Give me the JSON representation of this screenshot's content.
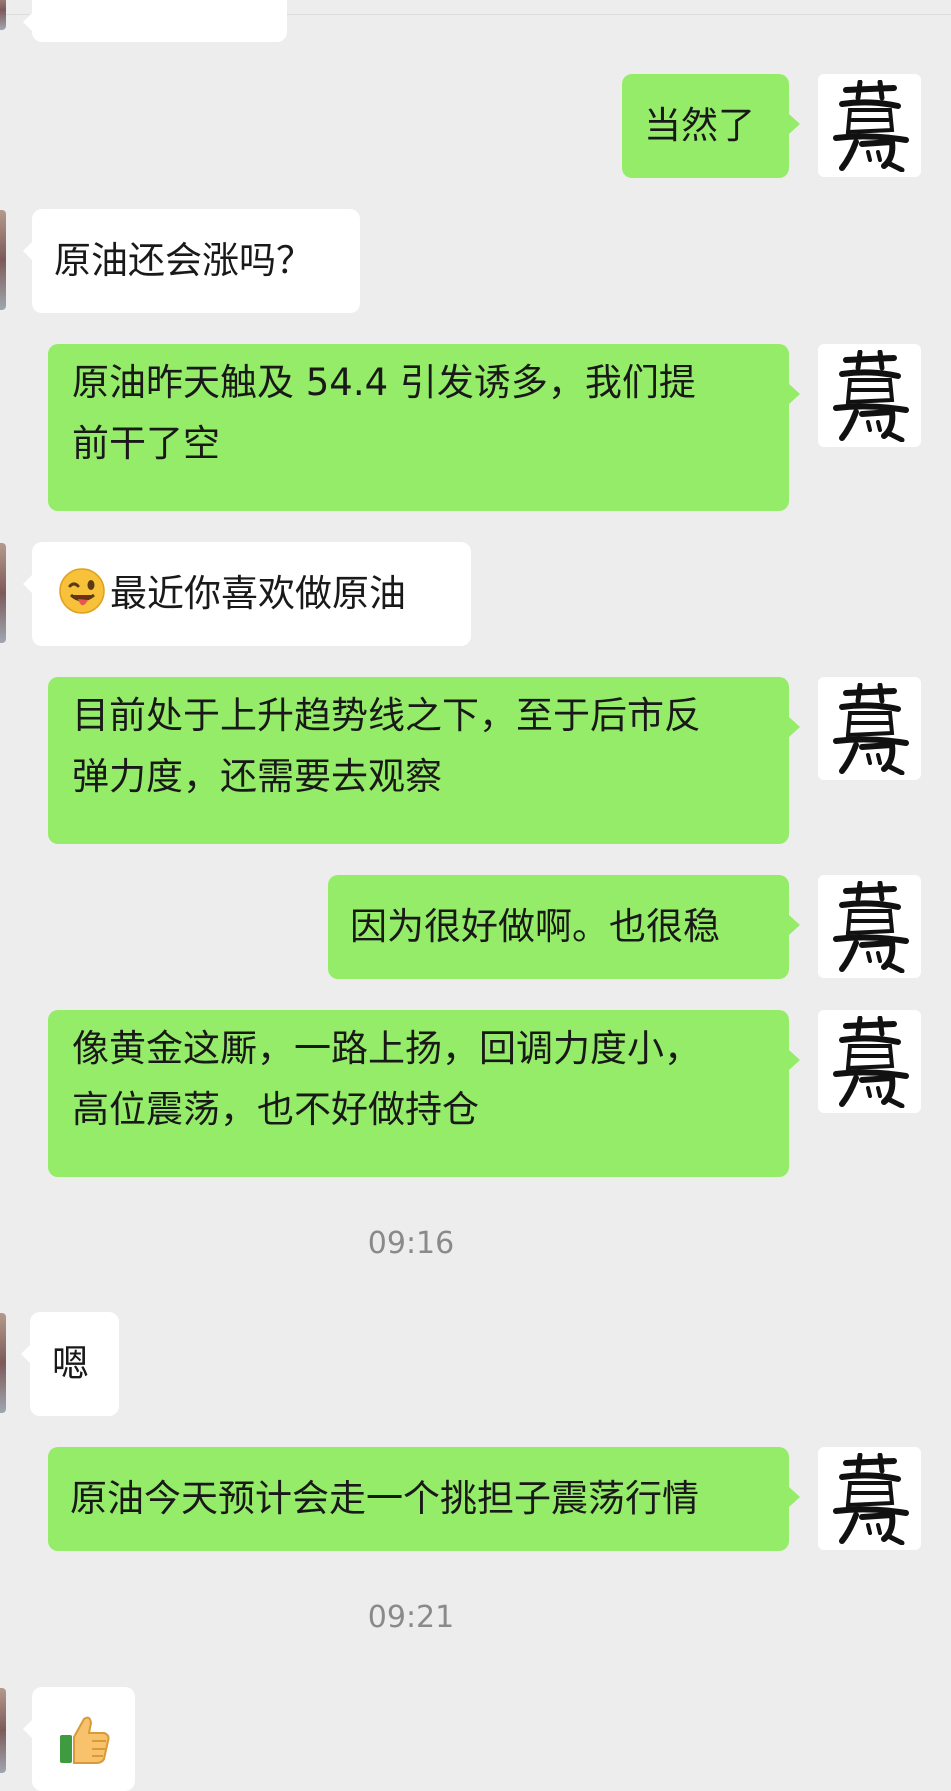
{
  "chat": {
    "messages": [
      {
        "id": "m1",
        "side": "in",
        "text": ""
      },
      {
        "id": "m2",
        "side": "out",
        "text": "当然了"
      },
      {
        "id": "m3",
        "side": "in",
        "text": "原油还会涨吗？"
      },
      {
        "id": "m4",
        "side": "out",
        "lines": [
          "原油昨天触及 54.4 引发诱多，我们提",
          "前干了空"
        ]
      },
      {
        "id": "m5",
        "side": "in",
        "emoji": "winking-face-with-tongue",
        "text": "最近你喜欢做原油"
      },
      {
        "id": "m6",
        "side": "out",
        "lines": [
          "目前处于上升趋势线之下，至于后市反",
          "弹力度，还需要去观察"
        ]
      },
      {
        "id": "m7",
        "side": "out",
        "text": "因为很好做啊。也很稳"
      },
      {
        "id": "m8",
        "side": "out",
        "lines": [
          "像黄金这厮，一路上扬，回调力度小，",
          "高位震荡，也不好做持仓"
        ]
      },
      {
        "id": "t1",
        "type": "timestamp",
        "text": "09:16"
      },
      {
        "id": "m9",
        "side": "in",
        "text": "嗯"
      },
      {
        "id": "m10",
        "side": "out",
        "text": "原油今天预计会走一个挑担子震荡行情"
      },
      {
        "id": "t2",
        "type": "timestamp",
        "text": "09:21"
      },
      {
        "id": "m11",
        "side": "in",
        "emoji": "thumbs-up",
        "text": ""
      }
    ]
  },
  "colors": {
    "background": "#ededed",
    "incoming_bubble": "#ffffff",
    "outgoing_bubble": "#95ec69",
    "timestamp_text": "#8a8a8a"
  },
  "icons": {
    "self_avatar": "calligraphy-avatar-icon",
    "peer_avatar": "peer-avatar-icon"
  }
}
